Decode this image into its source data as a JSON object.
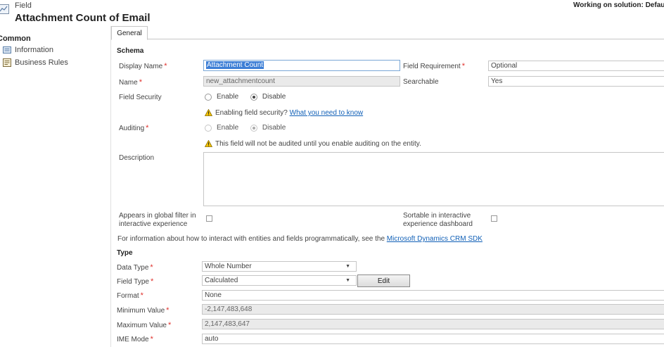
{
  "header": {
    "subtitle": "Field",
    "title": "Attachment Count of Email",
    "solution": "Working on solution: Defau"
  },
  "nav": {
    "section": "Common",
    "items": [
      {
        "label": "Information",
        "icon": "information-icon"
      },
      {
        "label": "Business Rules",
        "icon": "business-rules-icon"
      }
    ]
  },
  "tabs": [
    {
      "label": "General"
    }
  ],
  "schema": {
    "title": "Schema",
    "display_name": {
      "label": "Display Name",
      "value": "Attachment Count"
    },
    "name": {
      "label": "Name",
      "value": "new_attachmentcount"
    },
    "field_requirement": {
      "label": "Field Requirement",
      "value": "Optional"
    },
    "searchable": {
      "label": "Searchable",
      "value": "Yes"
    },
    "field_security": {
      "label": "Field Security",
      "options": [
        "Enable",
        "Disable"
      ],
      "selected": "Disable",
      "warning_text": "Enabling field security?",
      "warning_link": "What you need to know"
    },
    "auditing": {
      "label": "Auditing",
      "options": [
        "Enable",
        "Disable"
      ],
      "selected": "Disable",
      "warning_text": "This field will not be audited until you enable auditing on the entity."
    },
    "description": {
      "label": "Description",
      "value": ""
    },
    "global_filter": {
      "label_line1": "Appears in global filter in",
      "label_line2": "interactive experience",
      "checked": false
    },
    "sortable": {
      "label_line1": "Sortable in interactive",
      "label_line2": "experience dashboard",
      "checked": false
    },
    "info_text": "For information about how to interact with entities and fields programmatically, see the",
    "info_link": "Microsoft Dynamics CRM SDK"
  },
  "type": {
    "title": "Type",
    "data_type": {
      "label": "Data Type",
      "value": "Whole Number"
    },
    "field_type": {
      "label": "Field Type",
      "value": "Calculated",
      "edit_button": "Edit"
    },
    "format": {
      "label": "Format",
      "value": "None"
    },
    "min_value": {
      "label": "Minimum Value",
      "value": "-2,147,483,648"
    },
    "max_value": {
      "label": "Maximum Value",
      "value": "2,147,483,647"
    },
    "ime_mode": {
      "label": "IME Mode",
      "value": "auto"
    }
  },
  "colors": {
    "required": "#e0312c",
    "link": "#1160b7",
    "selection": "#3d7fd6"
  }
}
